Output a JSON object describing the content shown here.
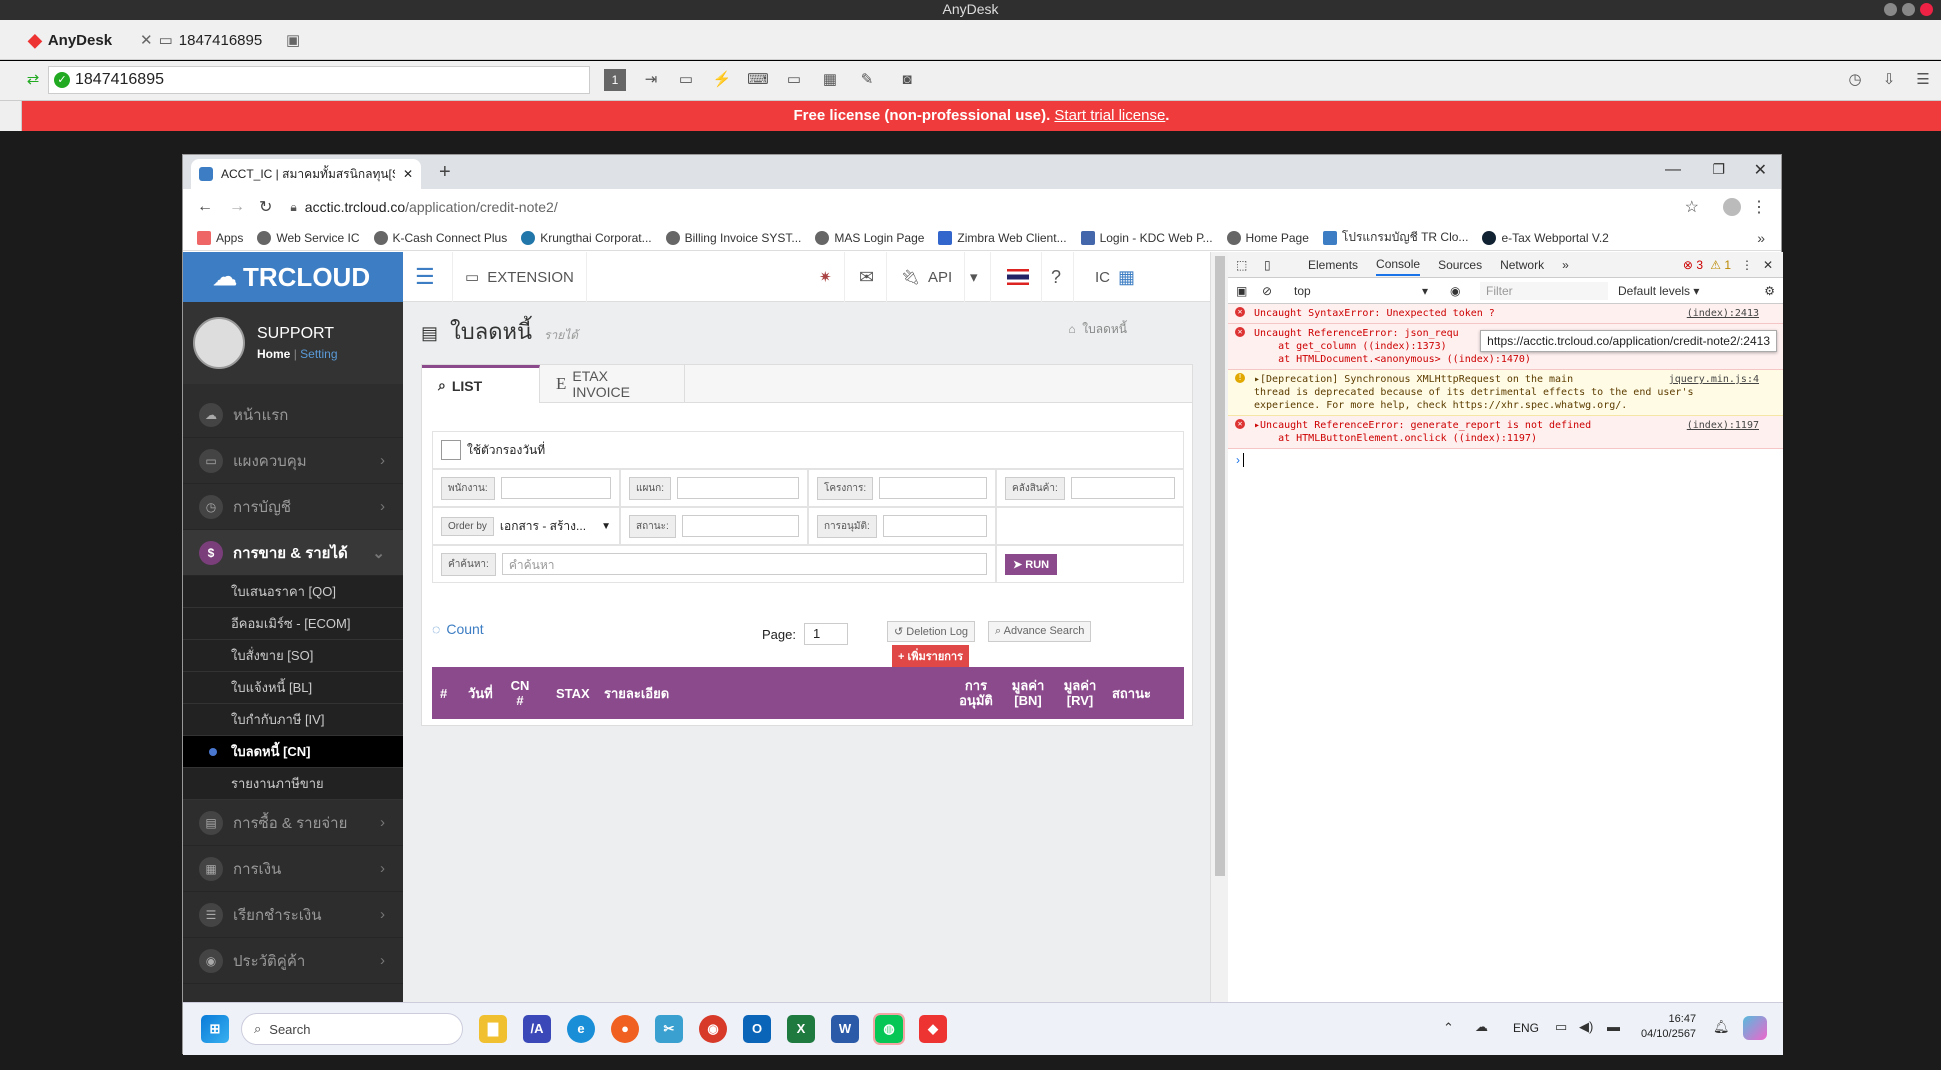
{
  "anydesk": {
    "window_title": "AnyDesk",
    "tab_app": "AnyDesk",
    "tab_session": "1847416895",
    "address": "1847416895",
    "toolbar_page": "1",
    "license_text": "Free license (non-professional use).",
    "license_link": "Start trial license",
    "license_end": "."
  },
  "browser": {
    "tab_title": "ACCT_IC | สมาคมทั้มสรนิกลทุน[Su",
    "url_host": "acctic.trcloud.co",
    "url_path": "/application/credit-note2/",
    "bookmarks": [
      "Apps",
      "Web Service IC",
      "K-Cash Connect Plus",
      "Krungthai Corporat...",
      "Billing Invoice SYST...",
      "MAS Login Page",
      "Zimbra Web Client...",
      "Login - KDC Web P...",
      "Home Page",
      "โปรแกรมบัญชี TR Clo...",
      "e-Tax Webportal V.2"
    ],
    "more": "»"
  },
  "app": {
    "logo": "TRCLOUD",
    "user": "SUPPORT",
    "home_link": "Home",
    "setting_link": "Setting",
    "menu": [
      {
        "label": "หน้าแรก",
        "icon": "☁"
      },
      {
        "label": "แผงควบคุม",
        "icon": "▭"
      },
      {
        "label": "การบัญชี",
        "icon": "◷"
      },
      {
        "label": "การขาย & รายได้",
        "icon": "$"
      },
      {
        "label": "การซื้อ & รายจ่าย",
        "icon": "▤"
      },
      {
        "label": "การเงิน",
        "icon": "▦"
      },
      {
        "label": "เรียกชำระเงิน",
        "icon": "☰"
      },
      {
        "label": "ประวัติคู่ค้า",
        "icon": "◉"
      }
    ],
    "submenu": [
      "ใบเสนอราคา [QO]",
      "อีคอมเมิร์ซ - [ECOM]",
      "ใบสั่งขาย [SO]",
      "ใบแจ้งหนี้ [BL]",
      "ใบกำกับภาษี [IV]",
      "ใบลดหนี้ [CN]",
      "รายงานภาษีขาย"
    ],
    "topnav": {
      "extension": "EXTENSION",
      "api": "API",
      "ic": "IC"
    },
    "page_title": "ใบลดหนี้",
    "page_sub": "รายได้",
    "breadcrumb": "ใบลดหนี้",
    "tabs": {
      "list": "LIST",
      "etax": "ETAX INVOICE"
    },
    "filter_date": "ใช้ตัวกรองวันที่",
    "labels": {
      "employee": "พนักงาน:",
      "dept": "แผนก:",
      "project": "โครงการ:",
      "warehouse": "คลังสินค้า:",
      "order_by": "Order by",
      "status": "สถานะ:",
      "approve": "การอนุมัติ:",
      "search": "คำค้นหา:"
    },
    "order_value": "เอกสาร - สร้าง...",
    "search_placeholder": "คำค้นหา",
    "run": "RUN",
    "count": "Count",
    "page_label": "Page:",
    "page_value": "1",
    "deletion_log": "Deletion Log",
    "advance_search": "Advance Search",
    "add_item": "+ เพิ่มรายการ",
    "columns": [
      "#",
      "วันที่",
      "CN #",
      "STAX",
      "รายละเอียด",
      "การ อนุมัติ",
      "มูลค่า [BN]",
      "มูลค่า [RV]",
      "สถานะ"
    ]
  },
  "devtools": {
    "tabs": [
      "Elements",
      "Console",
      "Sources",
      "Network",
      "»"
    ],
    "errors": "3",
    "warnings": "1",
    "context": "top",
    "filter_placeholder": "Filter",
    "levels": "Default levels ▾",
    "logs": [
      {
        "type": "err",
        "lines": [
          "Uncaught SyntaxError: Unexpected token ?"
        ],
        "src": "(index):2413"
      },
      {
        "type": "err",
        "lines": [
          "Uncaught ReferenceError: json_requ",
          "    at get_column ((index):1373)",
          "    at HTMLDocument.<anonymous> ((index):1470)"
        ],
        "src": ""
      },
      {
        "type": "warn",
        "lines": [
          "▸[Deprecation] Synchronous XMLHttpRequest on the main",
          "thread is deprecated because of its detrimental effects to the end user's",
          "experience. For more help, check https://xhr.spec.whatwg.org/."
        ],
        "src": "jquery.min.js:4"
      },
      {
        "type": "err",
        "lines": [
          "▸Uncaught ReferenceError: generate_report is not defined",
          "    at HTMLButtonElement.onclick ((index):1197)"
        ],
        "src": "(index):1197"
      }
    ],
    "tooltip": "https://acctic.trcloud.co/application/credit-note2/:2413"
  },
  "taskbar": {
    "search": "Search",
    "lang": "ENG",
    "time": "16:47",
    "date": "04/10/2567"
  }
}
